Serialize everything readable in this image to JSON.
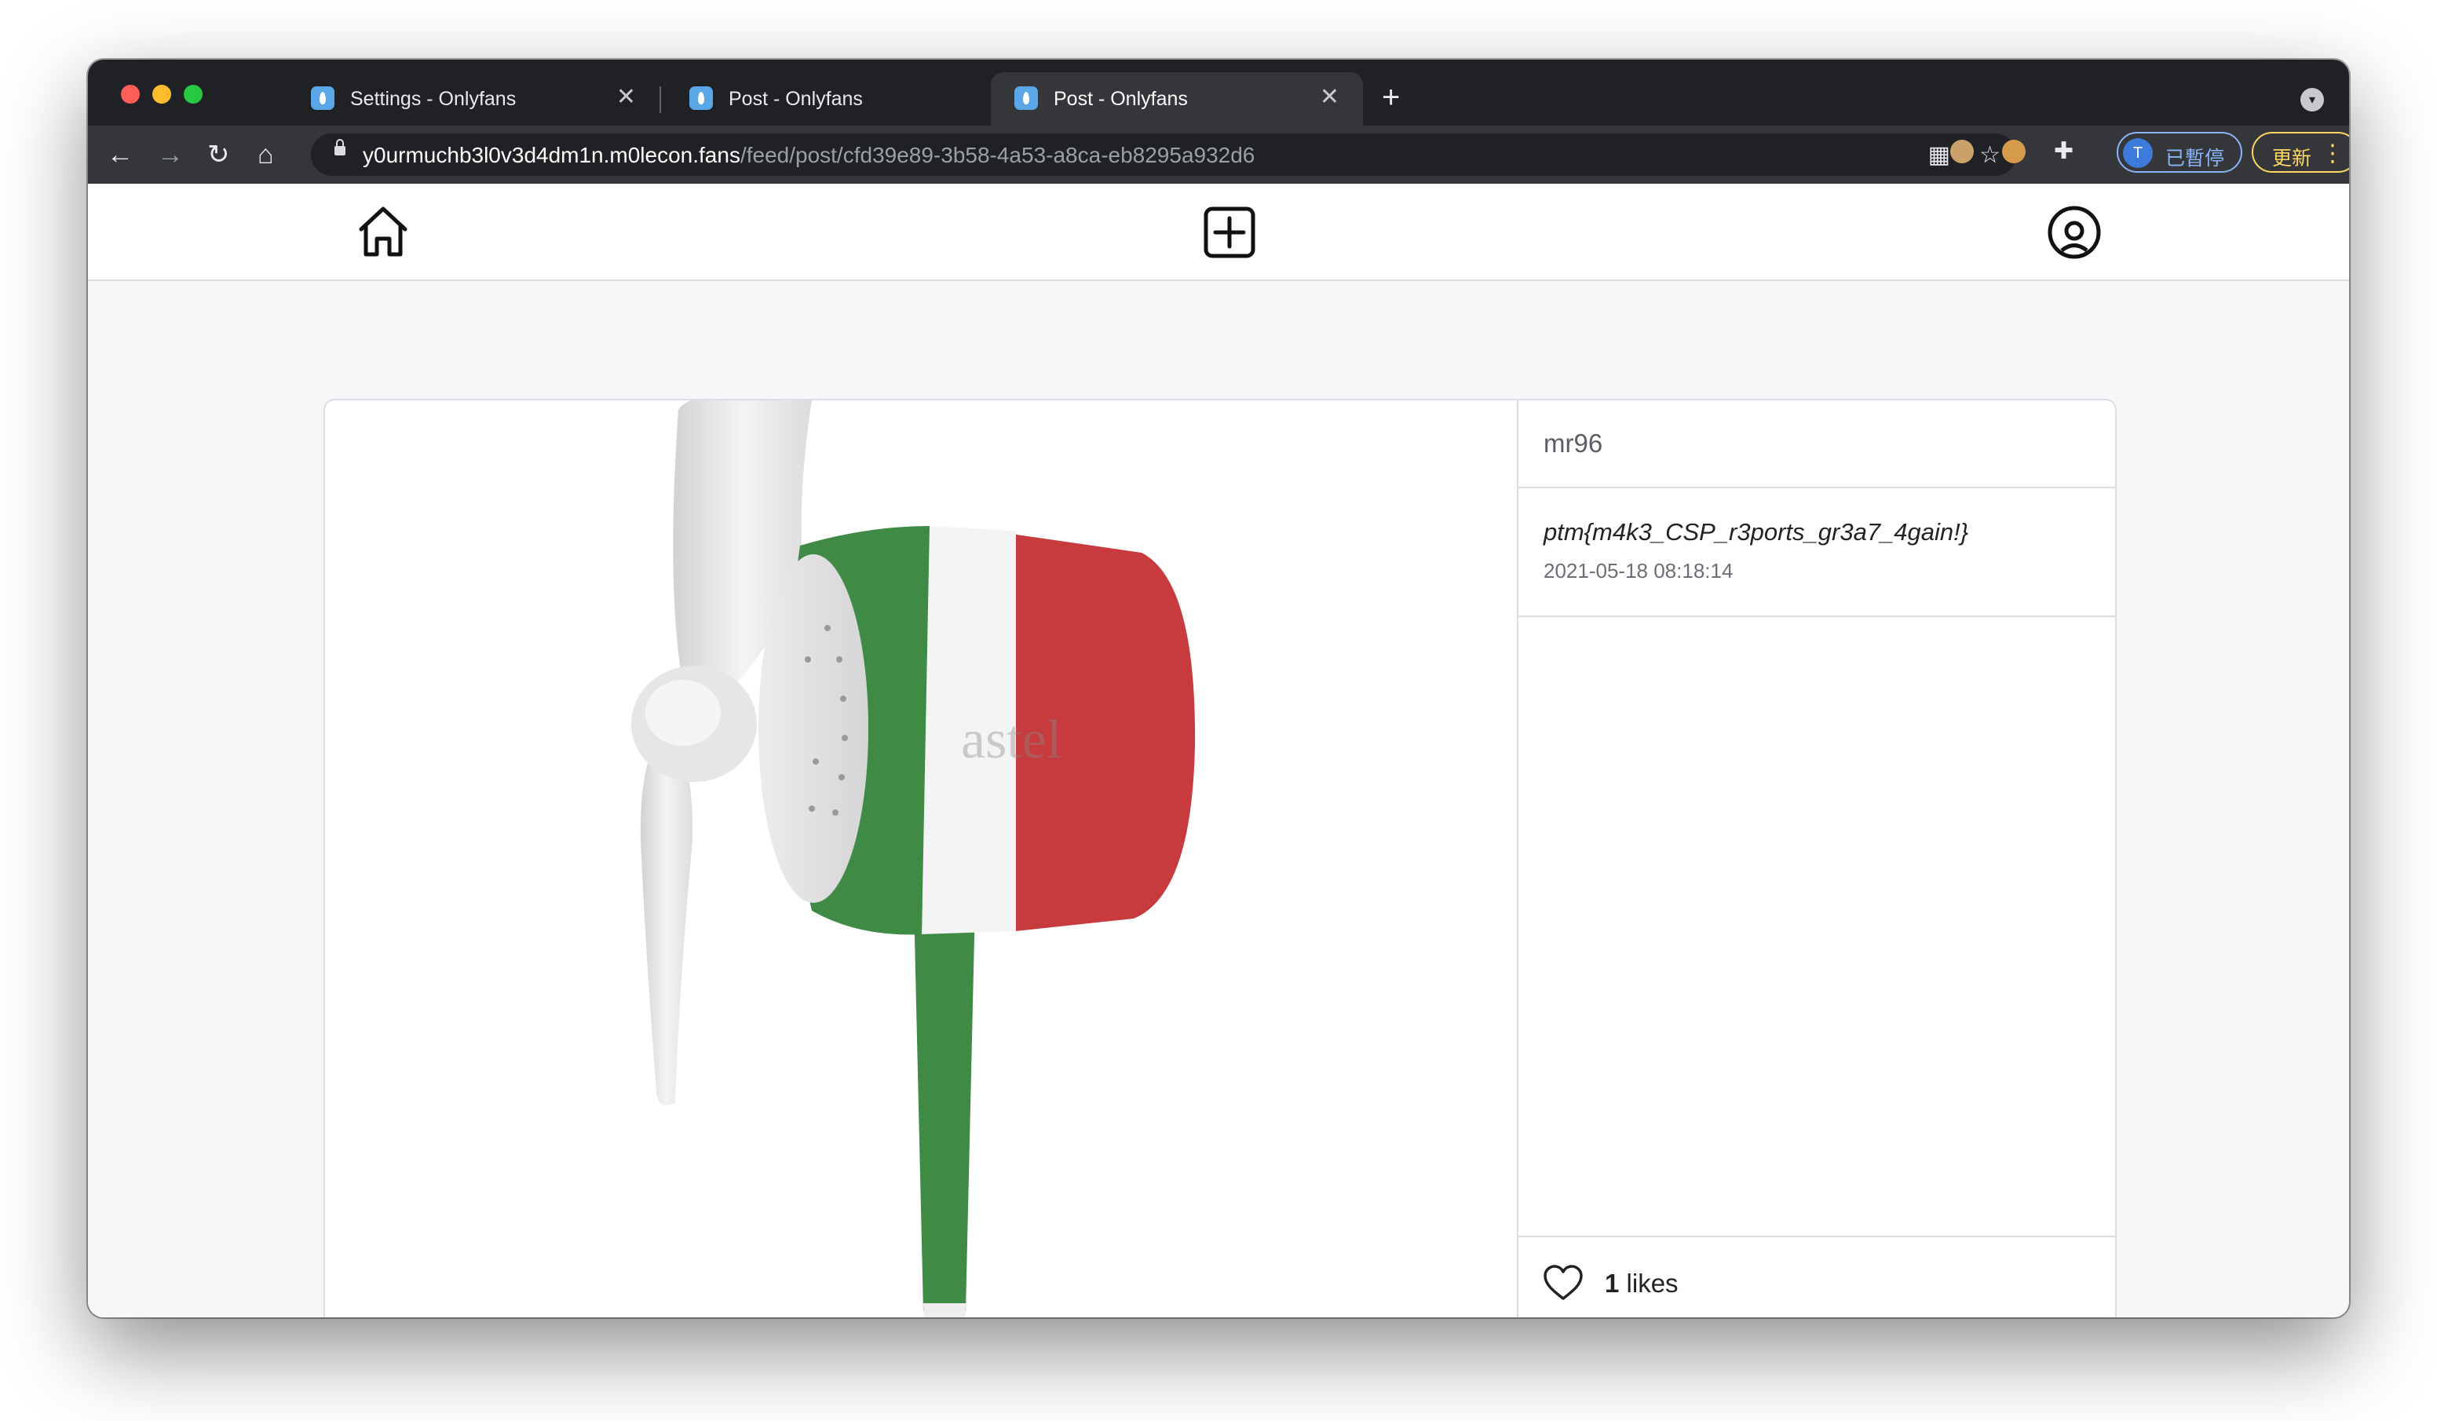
{
  "browser": {
    "tabs": [
      {
        "title": "Settings - Onlyfans",
        "close": "✕"
      },
      {
        "title": "Post - Onlyfans",
        "close": "✕"
      },
      {
        "title": "Post - Onlyfans",
        "close": "✕",
        "active": true
      }
    ],
    "new_tab": "+",
    "url_host": "y0urmuchb3l0v3d4dm1n.m0lecon.fans",
    "url_path": "/feed/post/cfd39e89-3b58-4a53-a8ca-eb8295a932d6",
    "nav": {
      "back": "←",
      "forward": "→",
      "reload": "↻",
      "home": "⌂"
    },
    "profile": {
      "initial": "T",
      "label": "已暫停"
    },
    "update": {
      "label": "更新",
      "more": "⋮"
    },
    "icons": [
      "tab-search-icon",
      "qr-code-icon",
      "bookmark-star-icon",
      "extension-icon",
      "cookie-icon",
      "puzzle-icon"
    ]
  },
  "app": {
    "nav_icons": [
      "home-icon",
      "new-post-icon",
      "profile-icon"
    ]
  },
  "post": {
    "author": "mr96",
    "caption": "ptm{m4k3_CSP_r3ports_gr3a7_4gain!}",
    "date": "2021-05-18 08:18:14",
    "likes_count": "1",
    "likes_label": "likes",
    "image": {
      "subject": "desk fan with Italian flag colored motor housing",
      "watermark": "astel"
    }
  },
  "colors": {
    "flag_green": "#3f8a45",
    "flag_white": "#f4f4f4",
    "flag_red": "#c73a3d",
    "profile_accent": "#8ab4f8",
    "update_accent": "#fdd663"
  }
}
